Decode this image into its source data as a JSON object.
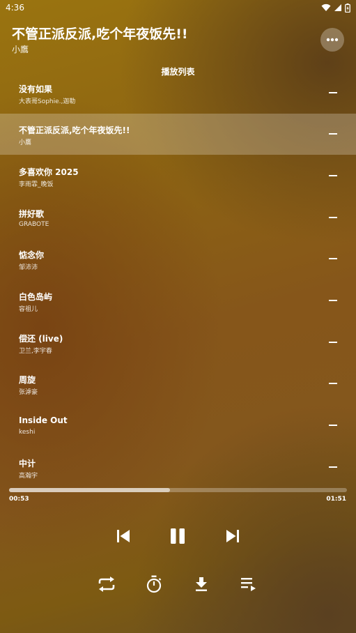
{
  "status_bar": {
    "time": "4:36"
  },
  "now_playing": {
    "title": "不管正派反派,吃个年夜饭先!!",
    "artist": "小鷹"
  },
  "playlist": {
    "label": "播放列表",
    "active_index": 1,
    "tracks": [
      {
        "title": "没有如果",
        "artist": "大表哥Sophie.,迦勒"
      },
      {
        "title": "不管正派反派,吃个年夜饭先!!",
        "artist": "小鷹"
      },
      {
        "title": "多喜欢你 2025",
        "artist": "李雨霏_晚饭"
      },
      {
        "title": "拼好歌",
        "artist": "GRABOTE"
      },
      {
        "title": "惦念你",
        "artist": "邹沛沛"
      },
      {
        "title": "白色岛屿",
        "artist": "容祖儿"
      },
      {
        "title": "偿还 (live)",
        "artist": "卫兰,李宇春"
      },
      {
        "title": "周旋",
        "artist": "张滹豪"
      },
      {
        "title": "Inside Out",
        "artist": "keshi"
      },
      {
        "title": "中计",
        "artist": "高瀚宇"
      }
    ]
  },
  "progress": {
    "current": "00:53",
    "total": "01:51",
    "fraction": 0.477
  },
  "icons": {
    "more": "more-horizontal-icon",
    "prev": "skip-previous-icon",
    "pause": "pause-icon",
    "next": "skip-next-icon",
    "repeat": "repeat-icon",
    "timer": "timer-icon",
    "download": "download-icon",
    "queue": "playlist-play-icon"
  }
}
